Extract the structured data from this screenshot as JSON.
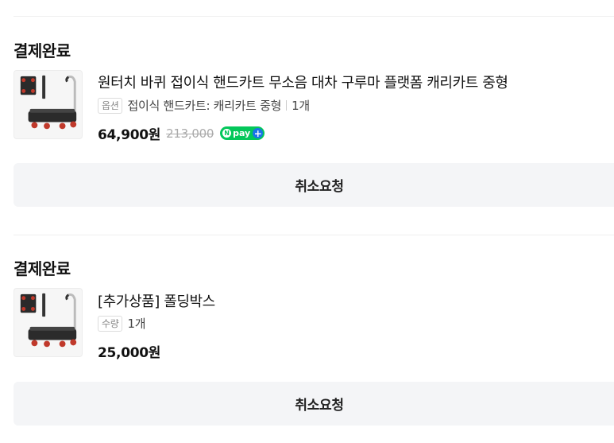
{
  "orders": [
    {
      "status": "결제완료",
      "product_name": "원터치 바퀴 접이식 핸드카트 무소음 대차 구루마 플랫폼 캐리카트 중형",
      "option_tag": "옵션",
      "option_text": "접이식 핸드카트: 캐리카트 중형",
      "quantity": "1개",
      "price": "64,900원",
      "original_price": "213,000",
      "npay_label": "pay",
      "thumbnail_icon": "folding-hand-cart-image",
      "cancel_label": "취소요청"
    },
    {
      "status": "결제완료",
      "product_name": "[추가상품] 폴딩박스",
      "option_tag": "수량",
      "quantity": "1개",
      "price": "25,000원",
      "thumbnail_icon": "folding-hand-cart-image",
      "cancel_label": "취소요청"
    }
  ],
  "colors": {
    "npay_green": "#03c75a",
    "npay_plus_blue": "#1a73e8",
    "button_bg": "#f4f5f7"
  }
}
